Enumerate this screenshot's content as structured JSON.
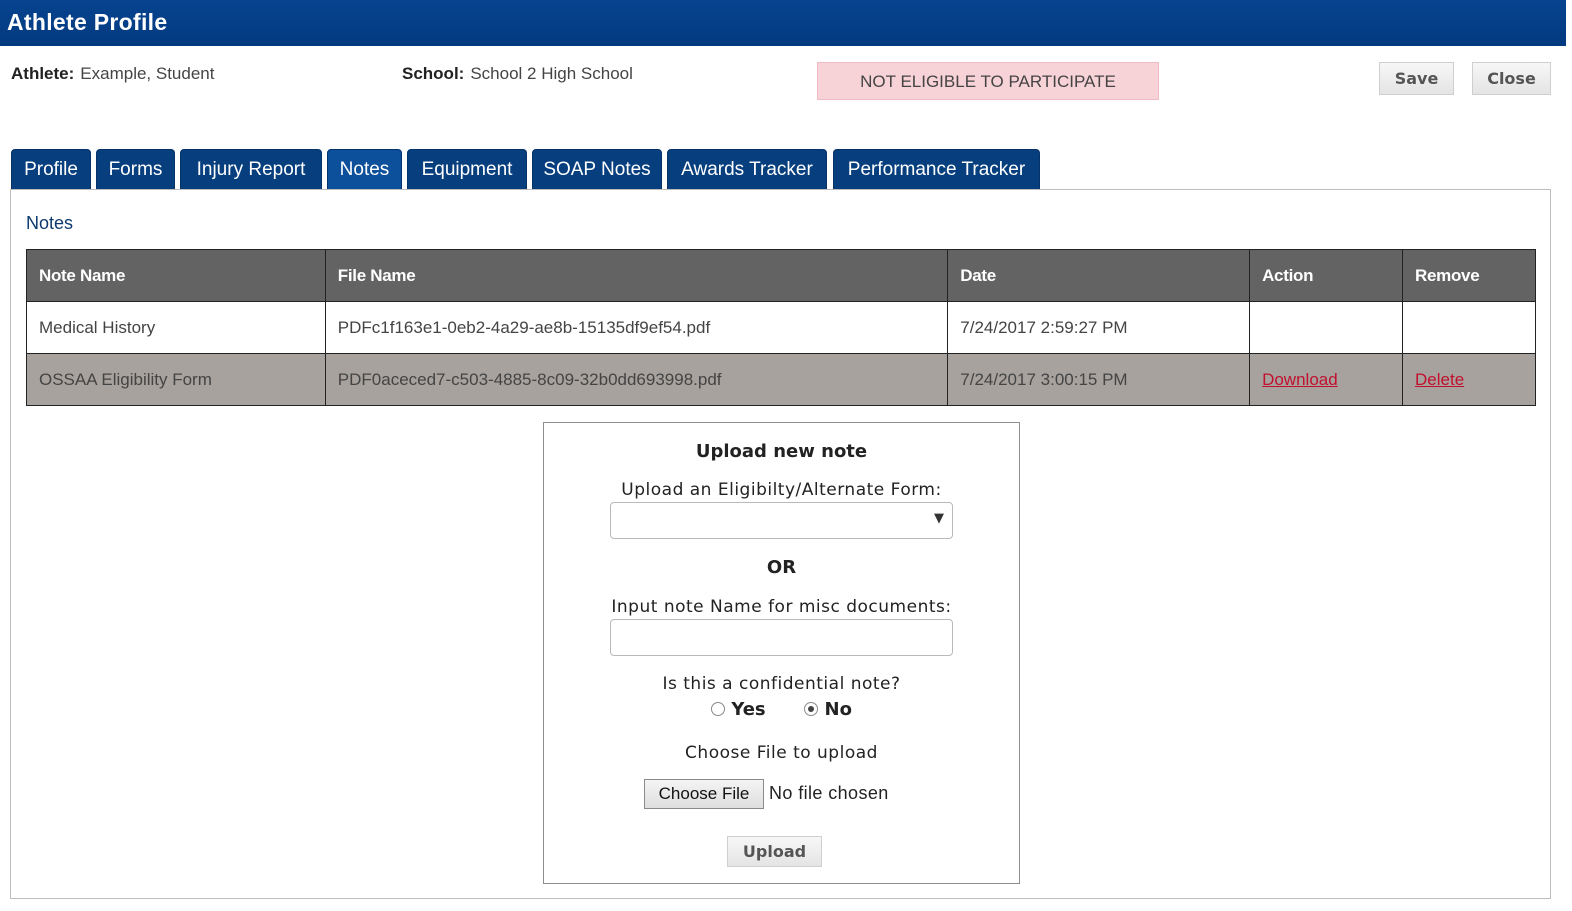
{
  "header": {
    "title": "Athlete Profile"
  },
  "info": {
    "athlete_label": "Athlete:",
    "athlete_value": "Example, Student",
    "school_label": "School:",
    "school_value": "School 2 High School",
    "eligibility_status": "NOT ELIGIBLE TO PARTICIPATE"
  },
  "actions": {
    "save_label": "Save",
    "close_label": "Close"
  },
  "tabs": [
    {
      "label": "Profile"
    },
    {
      "label": "Forms"
    },
    {
      "label": "Injury Report"
    },
    {
      "label": "Notes",
      "active": true
    },
    {
      "label": "Equipment"
    },
    {
      "label": "SOAP Notes"
    },
    {
      "label": "Awards Tracker"
    },
    {
      "label": "Performance Tracker"
    }
  ],
  "notes": {
    "section_title": "Notes",
    "columns": [
      "Note Name",
      "File Name",
      "Date",
      "Action",
      "Remove"
    ],
    "rows": [
      {
        "note_name": "Medical History",
        "file_name": "PDFc1f163e1-0eb2-4a29-ae8b-15135df9ef54.pdf",
        "date": "7/24/2017 2:59:27 PM",
        "action": "",
        "remove": ""
      },
      {
        "note_name": "OSSAA Eligibility Form",
        "file_name": "PDF0aceced7-c503-4885-8c09-32b0dd693998.pdf",
        "date": "7/24/2017 3:00:15 PM",
        "action": "Download",
        "remove": "Delete"
      }
    ]
  },
  "upload": {
    "title": "Upload new note",
    "form_label": "Upload an Eligibilty/Alternate Form:",
    "form_select_value": "",
    "or_label": "OR",
    "name_label": "Input note Name for misc documents:",
    "name_value": "",
    "confidential_label": "Is this a confidential note?",
    "yes_label": "Yes",
    "no_label": "No",
    "confidential_selected": "No",
    "file_label": "Choose File to upload",
    "choose_file_label": "Choose File",
    "file_status": "No file chosen",
    "upload_button": "Upload"
  }
}
